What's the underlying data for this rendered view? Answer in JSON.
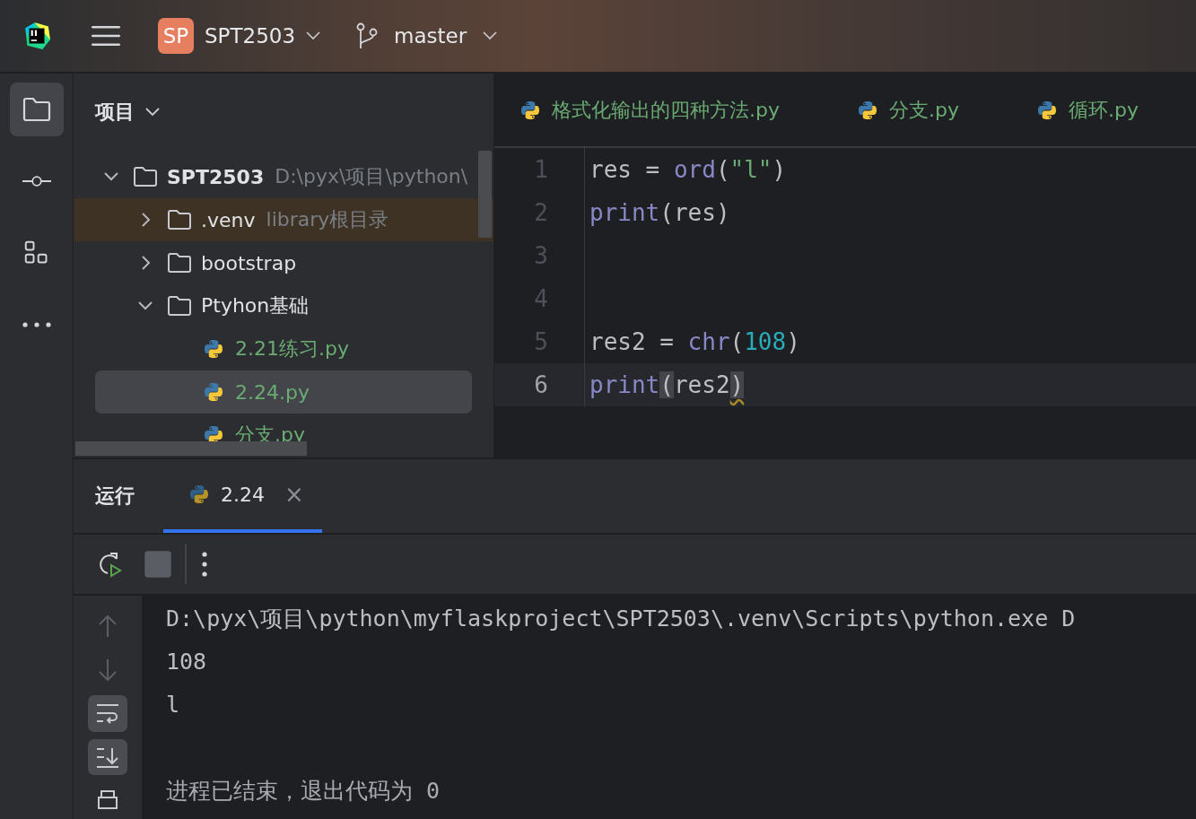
{
  "toolbar": {
    "project_badge": "SP",
    "project": "SPT2503",
    "branch": "master"
  },
  "stripe": [
    {
      "selected": true
    },
    {
      "selected": false
    },
    {
      "selected": false
    },
    {
      "selected": false
    }
  ],
  "project_panel": {
    "title": "项目",
    "tree": [
      {
        "name": "SPT2503",
        "kind": "root",
        "hint": "D:\\pyx\\项目\\python\\",
        "expanded": true,
        "selected": false,
        "children": [
          {
            "name": ".venv",
            "kind": "library",
            "hint": "library根目录",
            "expanded": false,
            "selected": false
          },
          {
            "name": "bootstrap",
            "kind": "folder",
            "expanded": false,
            "selected": false
          },
          {
            "name": "Ptyhon基础",
            "kind": "folder",
            "expanded": true,
            "selected": false,
            "children": [
              {
                "name": "2.21练习.py",
                "kind": "file",
                "selected": false
              },
              {
                "name": "2.24.py",
                "kind": "file",
                "selected": true
              },
              {
                "name": "分支.py",
                "kind": "file",
                "selected": false
              }
            ]
          }
        ]
      }
    ]
  },
  "editor": {
    "tabs": [
      {
        "label": "格式化输出的四种方法.py"
      },
      {
        "label": "分支.py"
      },
      {
        "label": "循环.py"
      }
    ],
    "lines": [
      {
        "number": "1",
        "current": false,
        "tokens": [
          {
            "text": "res = ",
            "kind": "plain"
          },
          {
            "text": "ord",
            "kind": "call"
          },
          {
            "text": "(",
            "kind": "plain"
          },
          {
            "text": "\"l\"",
            "kind": "string"
          },
          {
            "text": ")",
            "kind": "plain"
          }
        ]
      },
      {
        "number": "2",
        "current": false,
        "tokens": [
          {
            "text": "print",
            "kind": "call"
          },
          {
            "text": "(res)",
            "kind": "plain"
          }
        ]
      },
      {
        "number": "3",
        "current": false
      },
      {
        "number": "4",
        "current": false
      },
      {
        "number": "5",
        "current": false,
        "tokens": [
          {
            "text": "res2 = ",
            "kind": "plain"
          },
          {
            "text": "chr",
            "kind": "call"
          },
          {
            "text": "(",
            "kind": "plain"
          },
          {
            "text": "108",
            "kind": "number"
          },
          {
            "text": ")",
            "kind": "plain"
          }
        ]
      },
      {
        "number": "6",
        "current": true,
        "tokens": [
          {
            "text": "print",
            "kind": "call"
          },
          {
            "text": "(",
            "kind": "brace"
          },
          {
            "text": "res2",
            "kind": "plain"
          },
          {
            "text": ")",
            "kind": "squiggle"
          }
        ]
      }
    ]
  },
  "run": {
    "title": "运行",
    "tabs": [
      {
        "label": "2.24",
        "close": "×",
        "selected": true
      }
    ],
    "toolbar": [
      {
        "disabled": false
      },
      {
        "disabled": true
      },
      {
        "disabled": false
      }
    ],
    "side_tools": [
      {
        "disabled": true,
        "on": false
      },
      {
        "disabled": true,
        "on": false
      },
      {
        "disabled": false,
        "on": true
      },
      {
        "disabled": false,
        "on": true
      },
      {
        "disabled": false,
        "on": false
      }
    ],
    "console": [
      {
        "text": "D:\\pyx\\项目\\python\\myflaskproject\\SPT2503\\.venv\\Scripts\\python.exe D",
        "kind": "command"
      },
      {
        "text": "108",
        "kind": "output"
      },
      {
        "text": "l",
        "kind": "output"
      },
      {
        "text": "进程已结束，退出代码为 0",
        "kind": "exit"
      }
    ]
  }
}
